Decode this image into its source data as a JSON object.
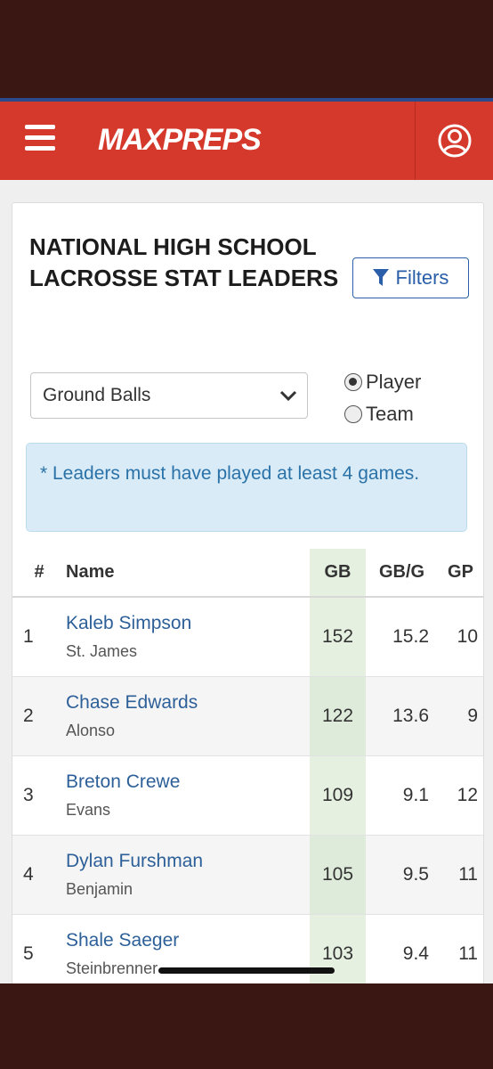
{
  "header": {
    "logo_text": "MAXPREPS",
    "menu_icon": "hamburger-icon",
    "account_icon": "user-icon",
    "brand_color": "#d5392c"
  },
  "page": {
    "title": "NATIONAL HIGH SCHOOL LACROSSE STAT LEADERS",
    "filters_label": "Filters",
    "stat_select": {
      "selected": "Ground Balls"
    },
    "view_options": [
      {
        "label": "Player",
        "checked": true
      },
      {
        "label": "Team",
        "checked": false
      }
    ],
    "notice": "* Leaders must have played at least 4 games."
  },
  "table": {
    "headers": {
      "rank": "#",
      "name": "Name",
      "gb": "GB",
      "gbg": "GB/G",
      "gp": "GP"
    },
    "rows": [
      {
        "rank": "1",
        "name": "Kaleb Simpson",
        "school": "St. James",
        "gb": "152",
        "gbg": "15.2",
        "gp": "10"
      },
      {
        "rank": "2",
        "name": "Chase Edwards",
        "school": "Alonso",
        "gb": "122",
        "gbg": "13.6",
        "gp": "9"
      },
      {
        "rank": "3",
        "name": "Breton Crewe",
        "school": "Evans",
        "gb": "109",
        "gbg": "9.1",
        "gp": "12"
      },
      {
        "rank": "4",
        "name": "Dylan Furshman",
        "school": "Benjamin",
        "gb": "105",
        "gbg": "9.5",
        "gp": "11"
      },
      {
        "rank": "5",
        "name": "Shale Saeger",
        "school": "Steinbrenner",
        "gb": "103",
        "gbg": "9.4",
        "gp": "11"
      }
    ]
  }
}
